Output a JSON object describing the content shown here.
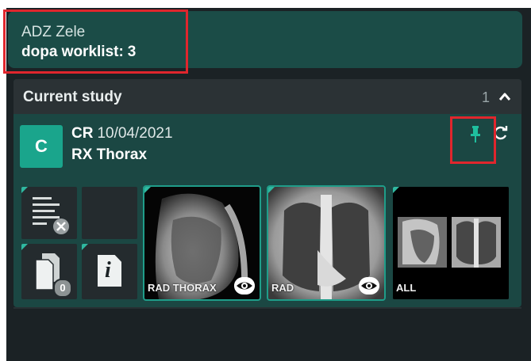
{
  "org": {
    "name": "ADZ Zele",
    "worklist_label": "dopa worklist:",
    "worklist_count": "3"
  },
  "study_panel": {
    "title": "Current study",
    "count": "1",
    "study": {
      "avatar_letter": "C",
      "modality": "CR",
      "date": "10/04/2021",
      "description": "RX Thorax"
    }
  },
  "tools": {
    "doc_count": "0",
    "info_glyph": "i"
  },
  "series": [
    {
      "caption": "RAD THORAX"
    },
    {
      "caption": "RAD"
    },
    {
      "caption": "ALL"
    }
  ],
  "icons": {
    "pin": "pin-icon",
    "refresh": "refresh-icon",
    "chevron": "chevron-up-icon",
    "report_cancel": "report-cancel-icon",
    "documents": "documents-icon",
    "info": "info-icon",
    "eye": "eye-icon"
  },
  "colors": {
    "accent": "#1aa58c",
    "highlight": "#e0262d",
    "panel": "#1b4743"
  }
}
